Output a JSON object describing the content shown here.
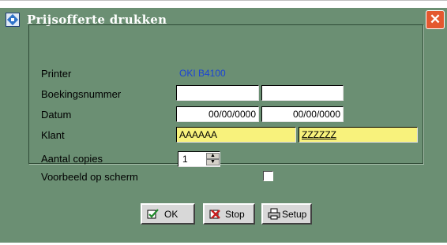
{
  "window": {
    "title": "Prijsofferte drukken",
    "close_glyph": "✕"
  },
  "form": {
    "printer_label": "Printer",
    "printer_value": "OKI B4100",
    "booking_label": "Boekingsnummer",
    "booking_from": "",
    "booking_to": "",
    "date_label": "Datum",
    "date_from": "00/00/0000",
    "date_to": "00/00/0000",
    "client_label": "Klant",
    "client_from": "AAAAAA",
    "client_to": "ZZZZZZ",
    "copies_label": "Aantal copies",
    "copies_value": "1",
    "preview_label": "Voorbeeld op scherm",
    "preview_checked": false
  },
  "buttons": {
    "ok": "OK",
    "stop": "Stop",
    "setup": "Setup"
  },
  "colors": {
    "panel": "#6b8f73",
    "yellow_field": "#f8f27c",
    "close": "#e4582f",
    "link_blue": "#1a44d6"
  }
}
